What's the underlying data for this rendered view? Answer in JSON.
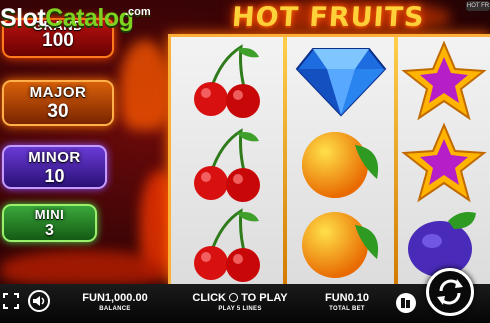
{
  "watermark": {
    "slot": "Slot",
    "catalog": "Catalog",
    "com": ".com"
  },
  "game": {
    "title": "HOT FRUITS",
    "corner_tag": "HOT FR"
  },
  "jackpots": [
    {
      "label": "GRAND",
      "value": "100",
      "color": "#b81010"
    },
    {
      "label": "MAJOR",
      "value": "30",
      "color": "#d9610a"
    },
    {
      "label": "MINOR",
      "value": "10",
      "color": "#6a3ad6"
    },
    {
      "label": "MINI",
      "value": "3",
      "color": "#3aa83a"
    }
  ],
  "reels": [
    [
      "cherry",
      "cherry",
      "cherry"
    ],
    [
      "diamond",
      "orange",
      "orange"
    ],
    [
      "star",
      "star",
      "plum"
    ]
  ],
  "bottom_bar": {
    "balance_value": "FUN1,000.00",
    "balance_label": "BALANCE",
    "spin_prompt_left": "CLICK",
    "spin_prompt_right": "TO PLAY",
    "lines_label": "PLAY 5 LINES",
    "bet_value": "FUN0.10",
    "bet_label": "TOTAL BET"
  },
  "icons": {
    "fullscreen": "fullscreen-icon",
    "sound": "speaker-icon",
    "coins": "coin-stack-icon",
    "spin": "spin-arrows-icon"
  },
  "colors": {
    "reel_frame": "#ffb03a",
    "background": "#3a0406",
    "title": "#ffd23a"
  }
}
